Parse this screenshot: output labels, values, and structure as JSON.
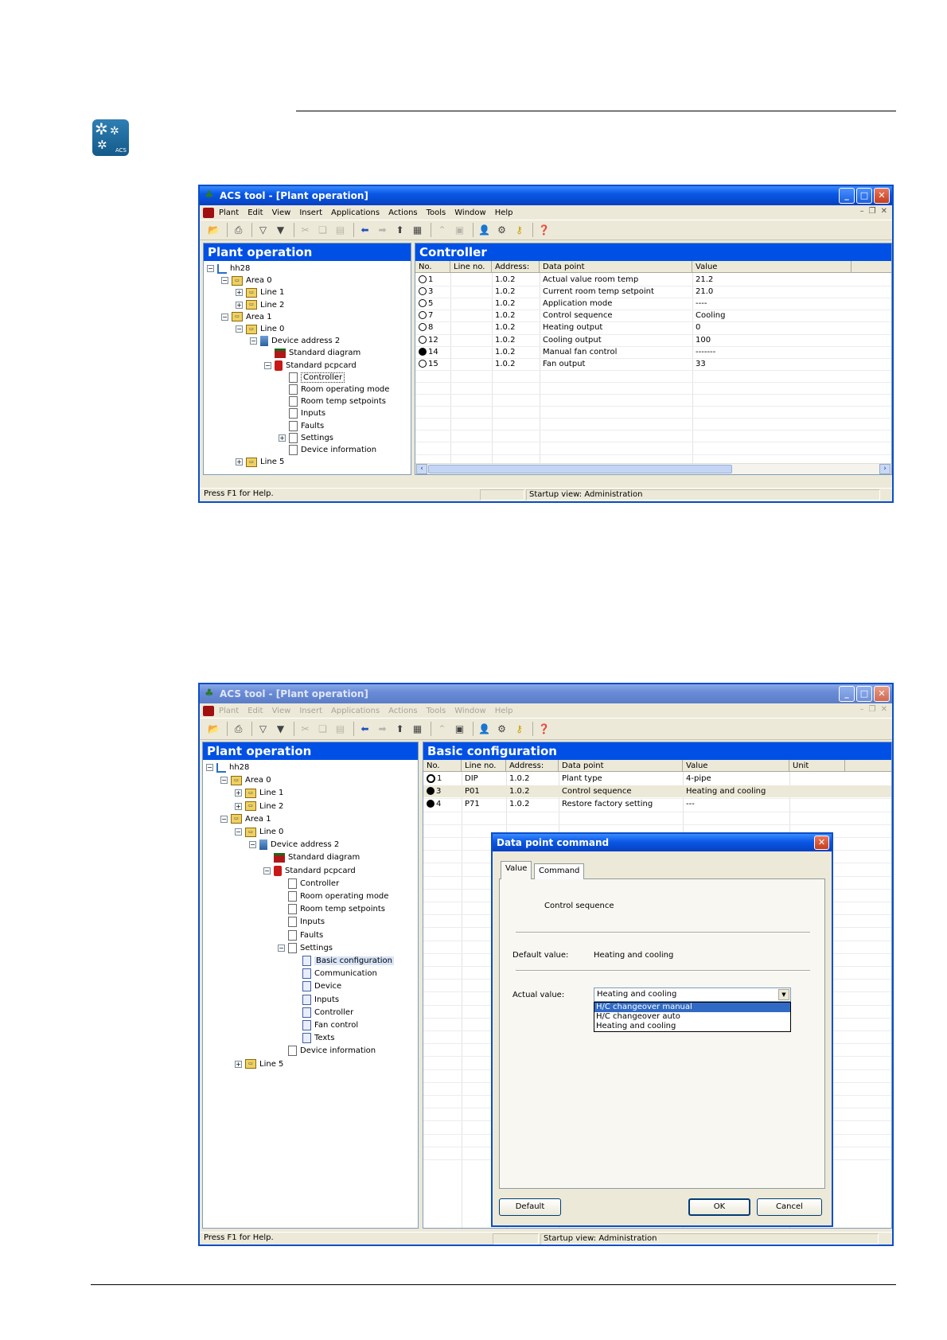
{
  "logo": {
    "label": "ACS"
  },
  "window1": {
    "title": "ACS tool - [Plant operation]",
    "menu": [
      "Plant",
      "Edit",
      "View",
      "Insert",
      "Applications",
      "Actions",
      "Tools",
      "Window",
      "Help"
    ],
    "left_header": "Plant operation",
    "right_header": "Controller",
    "tree": [
      {
        "label": "hh28",
        "exp": "−",
        "icon": "net",
        "indent": 0
      },
      {
        "label": "Area 0",
        "exp": "−",
        "icon": "area",
        "indent": 1
      },
      {
        "label": "Line 1",
        "exp": "+",
        "icon": "line",
        "indent": 2
      },
      {
        "label": "Line 2",
        "exp": "+",
        "icon": "line",
        "indent": 2
      },
      {
        "label": "Area 1",
        "exp": "−",
        "icon": "area",
        "indent": 1
      },
      {
        "label": "Line 0",
        "exp": "−",
        "icon": "line",
        "indent": 2
      },
      {
        "label": "Device address 2",
        "exp": "−",
        "icon": "dev",
        "indent": 3
      },
      {
        "label": "Standard diagram",
        "exp": "",
        "icon": "diag",
        "indent": 4
      },
      {
        "label": "Standard pcpcard",
        "exp": "−",
        "icon": "pcd",
        "indent": 4
      },
      {
        "label": "Controller",
        "exp": "",
        "icon": "page",
        "indent": 5,
        "selected": true
      },
      {
        "label": "Room operating mode",
        "exp": "",
        "icon": "page",
        "indent": 5
      },
      {
        "label": "Room temp setpoints",
        "exp": "",
        "icon": "page",
        "indent": 5
      },
      {
        "label": "Inputs",
        "exp": "",
        "icon": "page",
        "indent": 5
      },
      {
        "label": "Faults",
        "exp": "",
        "icon": "page",
        "indent": 5
      },
      {
        "label": "Settings",
        "exp": "+",
        "icon": "page",
        "indent": 5
      },
      {
        "label": "Device information",
        "exp": "",
        "icon": "page",
        "indent": 5
      },
      {
        "label": "Line 5",
        "exp": "+",
        "icon": "line",
        "indent": 2
      }
    ],
    "columns": [
      "No.",
      "Line no.",
      "Address:",
      "Data point",
      "Value"
    ],
    "rows": [
      {
        "marker": "open",
        "no": "1",
        "line": "",
        "address": "1.0.2",
        "datapoint": "Actual value room temp",
        "value": "21.2"
      },
      {
        "marker": "open",
        "no": "3",
        "line": "",
        "address": "1.0.2",
        "datapoint": "Current room temp setpoint",
        "value": "21.0"
      },
      {
        "marker": "open",
        "no": "5",
        "line": "",
        "address": "1.0.2",
        "datapoint": "Application mode",
        "value": "----"
      },
      {
        "marker": "open",
        "no": "7",
        "line": "",
        "address": "1.0.2",
        "datapoint": "Control sequence",
        "value": "Cooling"
      },
      {
        "marker": "open",
        "no": "8",
        "line": "",
        "address": "1.0.2",
        "datapoint": "Heating output",
        "value": "0"
      },
      {
        "marker": "open",
        "no": "12",
        "line": "",
        "address": "1.0.2",
        "datapoint": "Cooling output",
        "value": "100"
      },
      {
        "marker": "filled",
        "no": "14",
        "line": "",
        "address": "1.0.2",
        "datapoint": "Manual fan control",
        "value": "-------"
      },
      {
        "marker": "open",
        "no": "15",
        "line": "",
        "address": "1.0.2",
        "datapoint": "Fan output",
        "value": "33"
      }
    ],
    "status_left": "Press F1 for Help.",
    "status_right": "Startup view: Administration"
  },
  "window2": {
    "title": "ACS tool - [Plant operation]",
    "menu": [
      "Plant",
      "Edit",
      "View",
      "Insert",
      "Applications",
      "Actions",
      "Tools",
      "Window",
      "Help"
    ],
    "left_header": "Plant operation",
    "right_header": "Basic configuration",
    "tree": [
      {
        "label": "hh28",
        "exp": "−",
        "icon": "net",
        "indent": 0
      },
      {
        "label": "Area 0",
        "exp": "−",
        "icon": "area",
        "indent": 1
      },
      {
        "label": "Line 1",
        "exp": "+",
        "icon": "line",
        "indent": 2
      },
      {
        "label": "Line 2",
        "exp": "+",
        "icon": "line",
        "indent": 2
      },
      {
        "label": "Area 1",
        "exp": "−",
        "icon": "area",
        "indent": 1
      },
      {
        "label": "Line 0",
        "exp": "−",
        "icon": "line",
        "indent": 2
      },
      {
        "label": "Device address 2",
        "exp": "−",
        "icon": "dev",
        "indent": 3
      },
      {
        "label": "Standard diagram",
        "exp": "",
        "icon": "diag",
        "indent": 4
      },
      {
        "label": "Standard pcpcard",
        "exp": "−",
        "icon": "pcd",
        "indent": 4
      },
      {
        "label": "Controller",
        "exp": "",
        "icon": "page",
        "indent": 5
      },
      {
        "label": "Room operating mode",
        "exp": "",
        "icon": "page",
        "indent": 5
      },
      {
        "label": "Room temp setpoints",
        "exp": "",
        "icon": "page",
        "indent": 5
      },
      {
        "label": "Inputs",
        "exp": "",
        "icon": "page",
        "indent": 5
      },
      {
        "label": "Faults",
        "exp": "",
        "icon": "page",
        "indent": 5
      },
      {
        "label": "Settings",
        "exp": "−",
        "icon": "page",
        "indent": 5
      },
      {
        "label": "Basic configuration",
        "exp": "",
        "icon": "page2",
        "indent": 6,
        "highlighted": true
      },
      {
        "label": "Communication",
        "exp": "",
        "icon": "page2",
        "indent": 6
      },
      {
        "label": "Device",
        "exp": "",
        "icon": "page2",
        "indent": 6
      },
      {
        "label": "Inputs",
        "exp": "",
        "icon": "page2",
        "indent": 6
      },
      {
        "label": "Controller",
        "exp": "",
        "icon": "page2",
        "indent": 6
      },
      {
        "label": "Fan control",
        "exp": "",
        "icon": "page2",
        "indent": 6
      },
      {
        "label": "Texts",
        "exp": "",
        "icon": "page2",
        "indent": 6
      },
      {
        "label": "Device information",
        "exp": "",
        "icon": "page",
        "indent": 5
      },
      {
        "label": "Line 5",
        "exp": "+",
        "icon": "line",
        "indent": 2
      }
    ],
    "columns": [
      "No.",
      "Line no.",
      "Address:",
      "Data point",
      "Value",
      "Unit"
    ],
    "rows": [
      {
        "marker": "gear",
        "no": "1",
        "line": "DIP",
        "address": "1.0.2",
        "datapoint": "Plant type",
        "value": "4-pipe",
        "unit": ""
      },
      {
        "marker": "gearfilled",
        "no": "3",
        "line": "P01",
        "address": "1.0.2",
        "datapoint": "Control sequence",
        "value": "Heating and cooling",
        "unit": ""
      },
      {
        "marker": "filled",
        "no": "4",
        "line": "P71",
        "address": "1.0.2",
        "datapoint": "Restore factory setting",
        "value": "---",
        "unit": ""
      }
    ],
    "status_left": "Press F1 for Help.",
    "status_right": "Startup view: Administration",
    "dialog": {
      "title": "Data point command",
      "tabs": [
        "Value",
        "Command"
      ],
      "heading": "Control sequence",
      "default_label": "Default value:",
      "default_value": "Heating and cooling",
      "actual_label": "Actual value:",
      "actual_value": "Heating and cooling",
      "options": [
        "H/C changeover manual",
        "H/C changeover auto",
        "Heating and cooling"
      ],
      "btn_default": "Default",
      "btn_ok": "OK",
      "btn_cancel": "Cancel"
    }
  }
}
